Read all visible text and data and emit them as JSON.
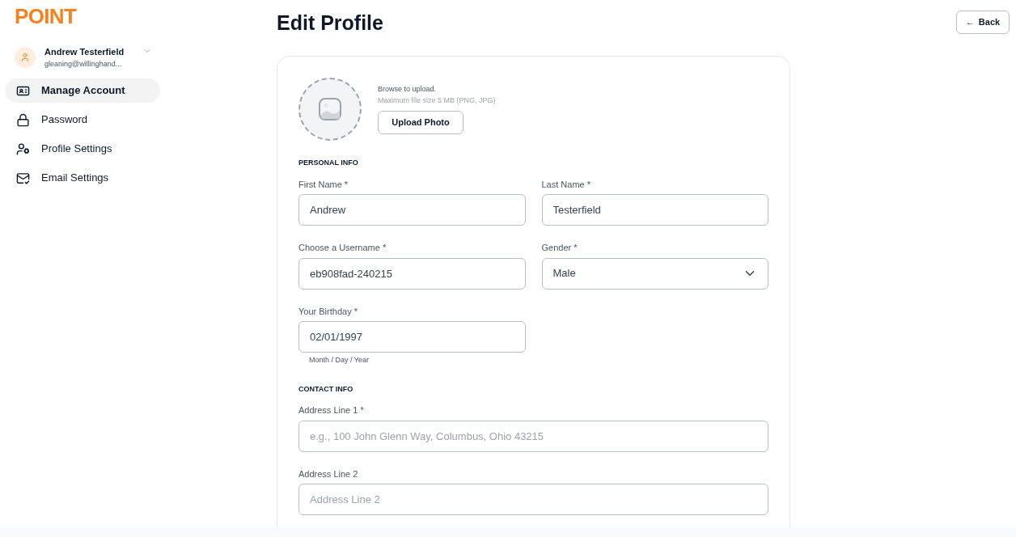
{
  "logo": "POINT",
  "user": {
    "name": "Andrew Testerfield",
    "email": "gleaning@willinghand..."
  },
  "nav": [
    {
      "label": "Manage Account",
      "selected": true
    },
    {
      "label": "Password",
      "selected": false
    },
    {
      "label": "Profile Settings",
      "selected": false
    },
    {
      "label": "Email Settings",
      "selected": false
    }
  ],
  "title": "Edit Profile",
  "back_button": {
    "arrow": "←",
    "label": "Back"
  },
  "upload": {
    "hint": "Browse to upload.",
    "limit": "Maximum file size 5 MB (PNG, JPG)",
    "button": "Upload Photo"
  },
  "sections": [
    {
      "title": "PERSONAL INFO",
      "rows": [
        {
          "kind": "pair",
          "fields": [
            {
              "label": "First Name *",
              "kind": "text",
              "value": "Andrew"
            },
            {
              "label": "Last Name *",
              "kind": "text",
              "value": "Testerfield"
            }
          ]
        },
        {
          "kind": "pair",
          "fields": [
            {
              "label": "Choose a Username *",
              "kind": "text",
              "value": "eb908fad-240215"
            },
            {
              "label": "Gender *",
              "kind": "select",
              "value": "Male"
            }
          ]
        },
        {
          "kind": "pair",
          "fields": [
            {
              "label": "Your Birthday *",
              "kind": "text",
              "value": "02/01/1997",
              "hint": "Month / Day / Year"
            }
          ]
        }
      ]
    },
    {
      "title": "CONTACT INFO",
      "rows": [
        {
          "kind": "wide",
          "fields": [
            {
              "label": "Address Line 1 *",
              "kind": "text",
              "placeholder": "e.g., 100 John Glenn Way, Columbus, Ohio 43215"
            }
          ]
        },
        {
          "kind": "wide",
          "fields": [
            {
              "label": "Address Line 2",
              "kind": "text",
              "placeholder": "Address Line 2"
            }
          ]
        }
      ]
    }
  ]
}
